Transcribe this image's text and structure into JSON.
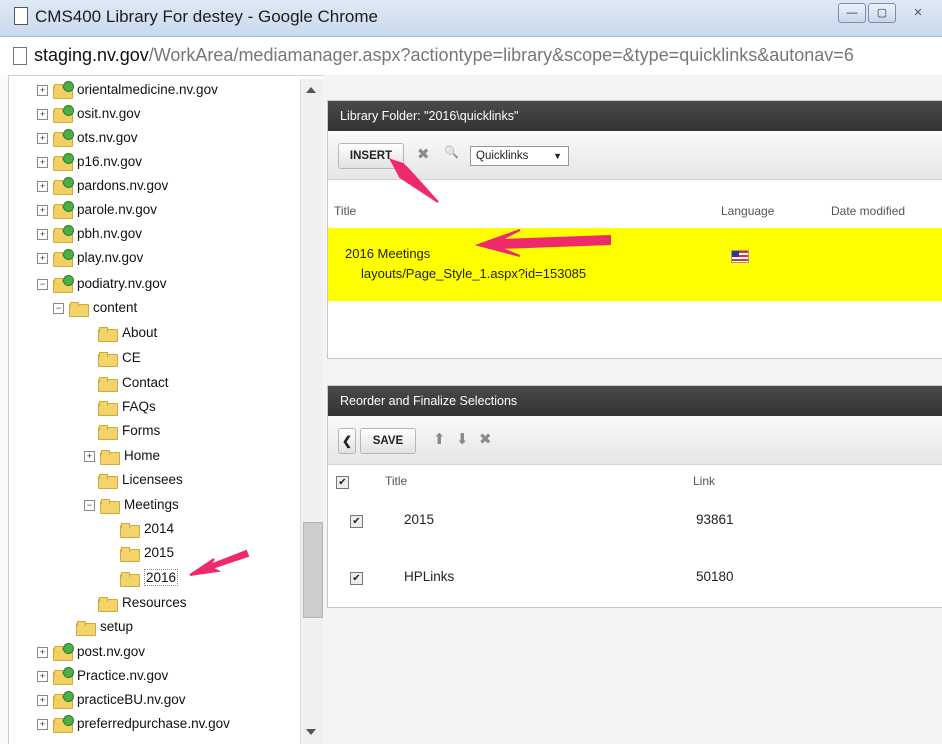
{
  "window": {
    "title": "CMS400 Library For destey - Google Chrome",
    "min_glyph": "—",
    "max_glyph": "▢",
    "close_glyph": "✕"
  },
  "address": {
    "host": "staging.nv.gov",
    "path": "/WorkArea/mediamanager.aspx?actiontype=library&scope=&type=quicklinks&autonav=6"
  },
  "tree": {
    "expand_glyph": "+",
    "collapse_glyph": "−",
    "sites_top": [
      "orientalmedicine.nv.gov",
      "osit.nv.gov",
      "ots.nv.gov",
      "p16.nv.gov",
      "pardons.nv.gov",
      "parole.nv.gov",
      "pbh.nv.gov",
      "play.nv.gov"
    ],
    "podiatry": "podiatry.nv.gov",
    "content": "content",
    "content_items": [
      "About",
      "CE",
      "Contact",
      "FAQs",
      "Forms",
      "Home",
      "Licensees"
    ],
    "meetings": "Meetings",
    "meeting_years": [
      "2014",
      "2015",
      "2016"
    ],
    "resources": "Resources",
    "setup": "setup",
    "sites_bottom": [
      "post.nv.gov",
      "Practice.nv.gov",
      "practiceBU.nv.gov",
      "preferredpurchase.nv.gov"
    ]
  },
  "library": {
    "header": "Library Folder: \"2016\\quicklinks\"",
    "insert_label": "INSERT",
    "delete_icon": "✖",
    "search_icon": "🔍",
    "dropdown_value": "Quicklinks",
    "dropdown_arrow": "▼",
    "columns": {
      "title": "Title",
      "language": "Language",
      "date": "Date modified"
    },
    "row": {
      "title": "2016 Meetings",
      "path": "layouts/Page_Style_1.aspx?id=153085"
    }
  },
  "reorder": {
    "header": "Reorder and Finalize Selections",
    "back_glyph": "❮",
    "save_label": "SAVE",
    "up_glyph": "⬆",
    "down_glyph": "⬇",
    "remove_glyph": "✖",
    "check_glyph": "✔",
    "columns": {
      "title": "Title",
      "link": "Link"
    },
    "rows": [
      {
        "title": "2015",
        "link": "93861"
      },
      {
        "title": "HPLinks",
        "link": "50180"
      }
    ]
  },
  "colors": {
    "highlight": "#ffff00",
    "annotation_arrow": "#ee2a6b",
    "panel_header": "#3a3a3a"
  }
}
